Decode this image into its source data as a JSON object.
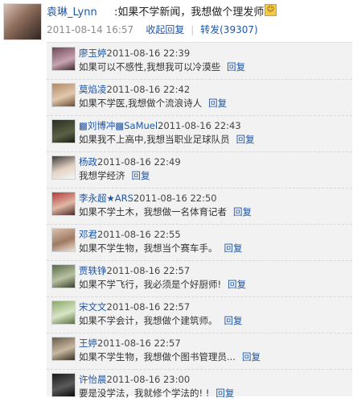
{
  "post": {
    "author": "袁琳_Lynn",
    "text": ":如果不学新闻，我想做个理发师。",
    "emoji_icon": "smiley-emoji-icon",
    "timestamp": "2011-08-14 16:57",
    "collapse_label": "收起回复",
    "repost_label": "转发(39307)",
    "separator": "|"
  },
  "comments": [
    {
      "name": "廖玉婷",
      "time": "2011-08-16 22:39",
      "text": "如果可以不感性,我想我可以冷漠些",
      "reply": "回复"
    },
    {
      "name": "莫焰凌",
      "time": "2011-08-16 22:42",
      "text": "如果不学医,我想做个流浪诗人",
      "reply": "回复"
    },
    {
      "name": "▩刘博冲▩SaMuel",
      "time": "2011-08-16 22:43",
      "text": "如果我不上高中,我想当职业足球队员",
      "reply": "回复"
    },
    {
      "name": "杨政",
      "time": "2011-08-16 22:49",
      "text": "我想学经济",
      "reply": "回复"
    },
    {
      "name": "李永超★ARS",
      "time": "2011-08-16 22:50",
      "text": "如果不学土木，我想做一名体育记者",
      "reply": "回复"
    },
    {
      "name": "邓君",
      "time": "2011-08-16 22:55",
      "text": "如果不学生物，我想当个赛车手。",
      "reply": "回复"
    },
    {
      "name": "贾轶铮",
      "time": "2011-08-16 22:57",
      "text": "如果不学飞行，我必须是个好厨师!",
      "reply": "回复"
    },
    {
      "name": "宋文文",
      "time": "2011-08-16 22:57",
      "text": "如果不学会计，我想做个建筑师。",
      "reply": "回复"
    },
    {
      "name": "王婷",
      "time": "2011-08-16 22:57",
      "text": "如果不学生物，我想做个图书管理员...",
      "reply": "回复"
    },
    {
      "name": "许怡晨",
      "time": "2011-08-16 23:00",
      "text": "要是没学法，我就修个学法的! !",
      "reply": "回复"
    }
  ],
  "colors": {
    "link": "#1f56a3",
    "comment_bg": "#f2f2f2",
    "meta_gray": "#8c8c8c"
  }
}
